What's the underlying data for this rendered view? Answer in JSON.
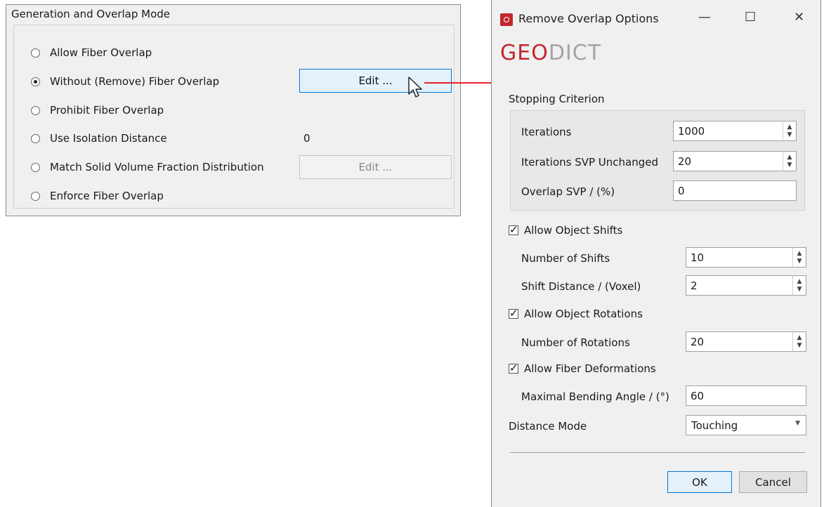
{
  "left_panel": {
    "title": "Generation and Overlap Mode",
    "options": [
      {
        "label": "Allow Fiber Overlap",
        "checked": false
      },
      {
        "label": "Without (Remove) Fiber Overlap",
        "checked": true
      },
      {
        "label": "Prohibit Fiber Overlap",
        "checked": false
      },
      {
        "label": "Use Isolation Distance",
        "checked": false
      },
      {
        "label": "Match Solid Volume Fraction Distribution",
        "checked": false
      },
      {
        "label": "Enforce Fiber Overlap",
        "checked": false
      }
    ],
    "edit_button_label": "Edit ...",
    "edit_button_disabled_label": "Edit ...",
    "isolation_distance_value": "0"
  },
  "dialog": {
    "title": "Remove Overlap Options",
    "logo_geo": "GEO",
    "logo_dict": "DICT",
    "stopping_criterion": {
      "title": "Stopping Criterion",
      "iterations_label": "Iterations",
      "iterations_value": "1000",
      "svp_unchanged_label": "Iterations SVP Unchanged",
      "svp_unchanged_value": "20",
      "overlap_svp_label": "Overlap SVP / (%)",
      "overlap_svp_value": "0"
    },
    "allow_object_shifts": {
      "label": "Allow Object Shifts",
      "checked": true,
      "num_shifts_label": "Number of Shifts",
      "num_shifts_value": "10",
      "shift_distance_label": "Shift Distance / (Voxel)",
      "shift_distance_value": "2"
    },
    "allow_object_rotations": {
      "label": "Allow Object Rotations",
      "checked": true,
      "num_rotations_label": "Number of Rotations",
      "num_rotations_value": "20"
    },
    "allow_fiber_deformations": {
      "label": "Allow Fiber Deformations",
      "checked": true,
      "max_bending_label": "Maximal Bending Angle / (°)",
      "max_bending_value": "60"
    },
    "distance_mode": {
      "label": "Distance Mode",
      "value": "Touching"
    },
    "ok_label": "OK",
    "cancel_label": "Cancel"
  },
  "colors": {
    "accent_red": "#c1272d",
    "arrow_red": "#e8202a",
    "focus_blue": "#0078d7"
  }
}
